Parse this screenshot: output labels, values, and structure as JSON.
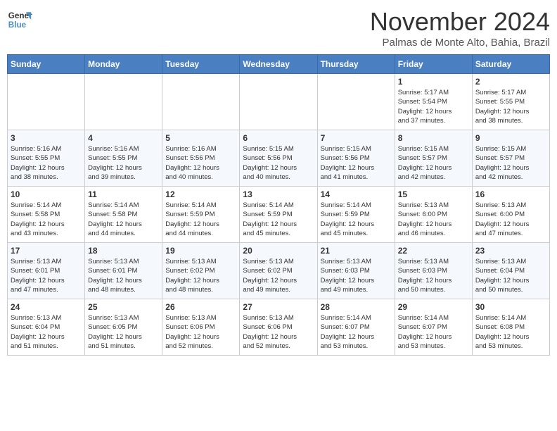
{
  "logo": {
    "line1": "General",
    "line2": "Blue"
  },
  "title": "November 2024",
  "location": "Palmas de Monte Alto, Bahia, Brazil",
  "weekdays": [
    "Sunday",
    "Monday",
    "Tuesday",
    "Wednesday",
    "Thursday",
    "Friday",
    "Saturday"
  ],
  "weeks": [
    [
      {
        "day": "",
        "info": ""
      },
      {
        "day": "",
        "info": ""
      },
      {
        "day": "",
        "info": ""
      },
      {
        "day": "",
        "info": ""
      },
      {
        "day": "",
        "info": ""
      },
      {
        "day": "1",
        "info": "Sunrise: 5:17 AM\nSunset: 5:54 PM\nDaylight: 12 hours\nand 37 minutes."
      },
      {
        "day": "2",
        "info": "Sunrise: 5:17 AM\nSunset: 5:55 PM\nDaylight: 12 hours\nand 38 minutes."
      }
    ],
    [
      {
        "day": "3",
        "info": "Sunrise: 5:16 AM\nSunset: 5:55 PM\nDaylight: 12 hours\nand 38 minutes."
      },
      {
        "day": "4",
        "info": "Sunrise: 5:16 AM\nSunset: 5:55 PM\nDaylight: 12 hours\nand 39 minutes."
      },
      {
        "day": "5",
        "info": "Sunrise: 5:16 AM\nSunset: 5:56 PM\nDaylight: 12 hours\nand 40 minutes."
      },
      {
        "day": "6",
        "info": "Sunrise: 5:15 AM\nSunset: 5:56 PM\nDaylight: 12 hours\nand 40 minutes."
      },
      {
        "day": "7",
        "info": "Sunrise: 5:15 AM\nSunset: 5:56 PM\nDaylight: 12 hours\nand 41 minutes."
      },
      {
        "day": "8",
        "info": "Sunrise: 5:15 AM\nSunset: 5:57 PM\nDaylight: 12 hours\nand 42 minutes."
      },
      {
        "day": "9",
        "info": "Sunrise: 5:15 AM\nSunset: 5:57 PM\nDaylight: 12 hours\nand 42 minutes."
      }
    ],
    [
      {
        "day": "10",
        "info": "Sunrise: 5:14 AM\nSunset: 5:58 PM\nDaylight: 12 hours\nand 43 minutes."
      },
      {
        "day": "11",
        "info": "Sunrise: 5:14 AM\nSunset: 5:58 PM\nDaylight: 12 hours\nand 44 minutes."
      },
      {
        "day": "12",
        "info": "Sunrise: 5:14 AM\nSunset: 5:59 PM\nDaylight: 12 hours\nand 44 minutes."
      },
      {
        "day": "13",
        "info": "Sunrise: 5:14 AM\nSunset: 5:59 PM\nDaylight: 12 hours\nand 45 minutes."
      },
      {
        "day": "14",
        "info": "Sunrise: 5:14 AM\nSunset: 5:59 PM\nDaylight: 12 hours\nand 45 minutes."
      },
      {
        "day": "15",
        "info": "Sunrise: 5:13 AM\nSunset: 6:00 PM\nDaylight: 12 hours\nand 46 minutes."
      },
      {
        "day": "16",
        "info": "Sunrise: 5:13 AM\nSunset: 6:00 PM\nDaylight: 12 hours\nand 47 minutes."
      }
    ],
    [
      {
        "day": "17",
        "info": "Sunrise: 5:13 AM\nSunset: 6:01 PM\nDaylight: 12 hours\nand 47 minutes."
      },
      {
        "day": "18",
        "info": "Sunrise: 5:13 AM\nSunset: 6:01 PM\nDaylight: 12 hours\nand 48 minutes."
      },
      {
        "day": "19",
        "info": "Sunrise: 5:13 AM\nSunset: 6:02 PM\nDaylight: 12 hours\nand 48 minutes."
      },
      {
        "day": "20",
        "info": "Sunrise: 5:13 AM\nSunset: 6:02 PM\nDaylight: 12 hours\nand 49 minutes."
      },
      {
        "day": "21",
        "info": "Sunrise: 5:13 AM\nSunset: 6:03 PM\nDaylight: 12 hours\nand 49 minutes."
      },
      {
        "day": "22",
        "info": "Sunrise: 5:13 AM\nSunset: 6:03 PM\nDaylight: 12 hours\nand 50 minutes."
      },
      {
        "day": "23",
        "info": "Sunrise: 5:13 AM\nSunset: 6:04 PM\nDaylight: 12 hours\nand 50 minutes."
      }
    ],
    [
      {
        "day": "24",
        "info": "Sunrise: 5:13 AM\nSunset: 6:04 PM\nDaylight: 12 hours\nand 51 minutes."
      },
      {
        "day": "25",
        "info": "Sunrise: 5:13 AM\nSunset: 6:05 PM\nDaylight: 12 hours\nand 51 minutes."
      },
      {
        "day": "26",
        "info": "Sunrise: 5:13 AM\nSunset: 6:06 PM\nDaylight: 12 hours\nand 52 minutes."
      },
      {
        "day": "27",
        "info": "Sunrise: 5:13 AM\nSunset: 6:06 PM\nDaylight: 12 hours\nand 52 minutes."
      },
      {
        "day": "28",
        "info": "Sunrise: 5:14 AM\nSunset: 6:07 PM\nDaylight: 12 hours\nand 53 minutes."
      },
      {
        "day": "29",
        "info": "Sunrise: 5:14 AM\nSunset: 6:07 PM\nDaylight: 12 hours\nand 53 minutes."
      },
      {
        "day": "30",
        "info": "Sunrise: 5:14 AM\nSunset: 6:08 PM\nDaylight: 12 hours\nand 53 minutes."
      }
    ]
  ]
}
